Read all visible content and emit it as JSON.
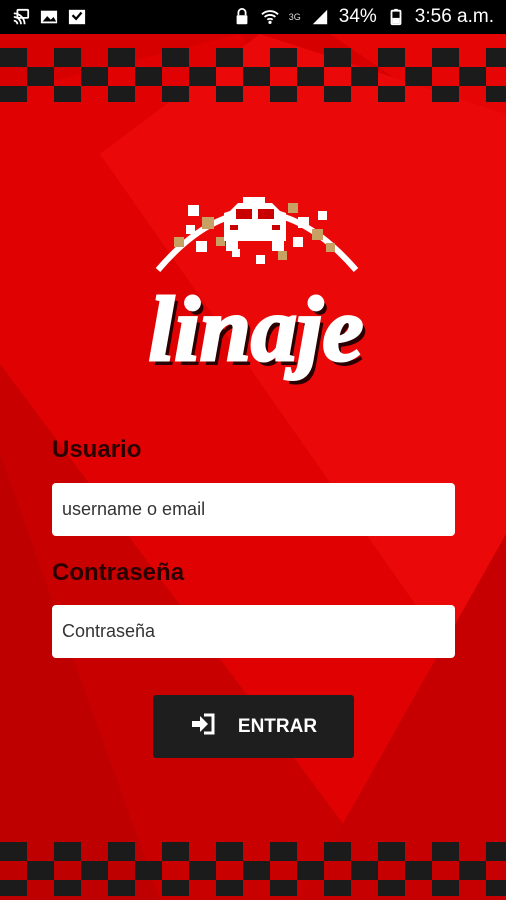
{
  "status_bar": {
    "icons_left": [
      "cast-icon",
      "image-icon",
      "download-icon"
    ],
    "network": "3G",
    "battery_percent": "34%",
    "time": "3:56 a.m."
  },
  "app": {
    "logo_text": "linaje",
    "colors": {
      "primary": "#d80000",
      "dark": "#1e1e1e",
      "label": "#2a0000"
    }
  },
  "form": {
    "username_label": "Usuario",
    "username_placeholder": "username o email",
    "password_label": "Contraseña",
    "password_placeholder": "Contraseña",
    "submit_label": "ENTRAR"
  }
}
